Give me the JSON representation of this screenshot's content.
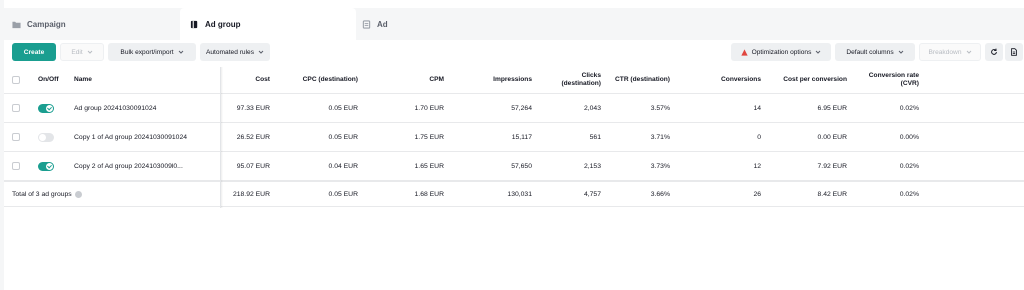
{
  "tabs": [
    {
      "label": "Campaign",
      "icon": "folder-icon"
    },
    {
      "label": "Ad group",
      "icon": "ad-group-icon"
    },
    {
      "label": "Ad",
      "icon": "ad-icon"
    }
  ],
  "toolbar": {
    "create_label": "Create",
    "edit_label": "Edit",
    "bulk_label": "Bulk export/import",
    "rules_label": "Automated rules",
    "optimization_label": "Optimization options",
    "columns_label": "Default columns",
    "breakdown_label": "Breakdown"
  },
  "table": {
    "headers": {
      "onoff": "On/Off",
      "name": "Name",
      "cost": "Cost",
      "cpc": "CPC (destination)",
      "cpm": "CPM",
      "impressions": "Impressions",
      "clicks": "Clicks (destination)",
      "ctr": "CTR (destination)",
      "conversions": "Conversions",
      "cpconv": "Cost per conversion",
      "cvr": "Conversion rate (CVR)"
    },
    "rows": [
      {
        "on": true,
        "name": "Ad group 20241030091024",
        "cost": "97.33 EUR",
        "cpc": "0.05 EUR",
        "cpm": "1.70 EUR",
        "impressions": "57,264",
        "clicks": "2,043",
        "ctr": "3.57%",
        "conversions": "14",
        "cpconv": "6.95 EUR",
        "cvr": "0.02%"
      },
      {
        "on": false,
        "name": "Copy 1 of Ad group 20241030091024",
        "cost": "26.52 EUR",
        "cpc": "0.05 EUR",
        "cpm": "1.75 EUR",
        "impressions": "15,117",
        "clicks": "561",
        "ctr": "3.71%",
        "conversions": "0",
        "cpconv": "0.00 EUR",
        "cvr": "0.00%"
      },
      {
        "on": true,
        "name": "Copy 2 of Ad group 2024103009l0...",
        "cost": "95.07 EUR",
        "cpc": "0.04 EUR",
        "cpm": "1.65 EUR",
        "impressions": "57,650",
        "clicks": "2,153",
        "ctr": "3.73%",
        "conversions": "12",
        "cpconv": "7.92 EUR",
        "cvr": "0.02%"
      }
    ],
    "total": {
      "label": "Total of 3 ad groups",
      "cost": "218.92 EUR",
      "cpc": "0.05 EUR",
      "cpm": "1.68 EUR",
      "impressions": "130,031",
      "clicks": "4,757",
      "ctr": "3.66%",
      "conversions": "26",
      "cpconv": "8.42 EUR",
      "cvr": "0.02%"
    }
  },
  "colors": {
    "accent": "#1a9e90",
    "warning": "#e0463f"
  }
}
